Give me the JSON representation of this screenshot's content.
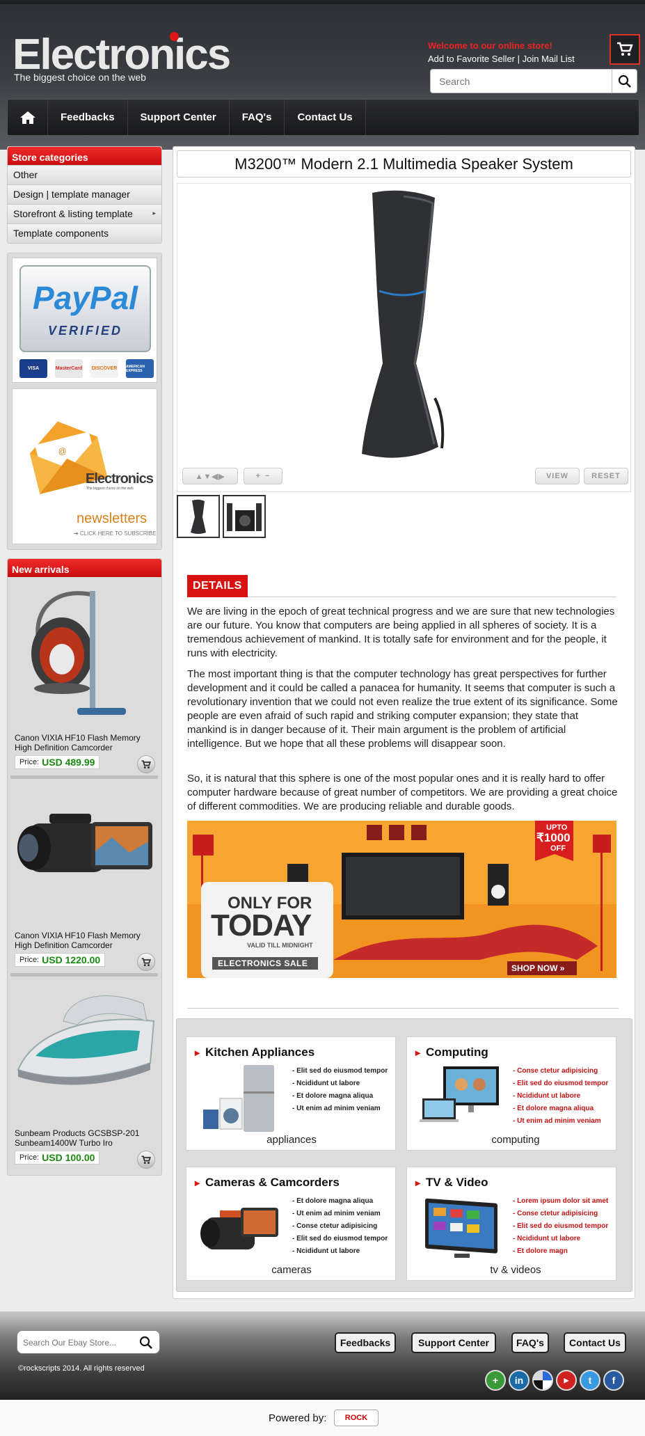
{
  "header": {
    "logo": "Electronics",
    "tagline": "The biggest choice on the web",
    "welcome": "Welcome to our online store!",
    "add_favorite": "Add to Favorite Seller",
    "link_sep": " | ",
    "join_mail": "Join Mail List",
    "search_placeholder": "Search",
    "cart_icon": "cart-icon",
    "search_icon": "search-icon"
  },
  "nav": {
    "home_icon": "home-icon",
    "items": [
      "Feedbacks",
      "Support Center",
      "FAQ's",
      "Contact Us"
    ]
  },
  "sidebar": {
    "categories_title": "Store categories",
    "categories": [
      "Other",
      "Design | template manager",
      "Storefront & listing template",
      "Template components"
    ],
    "paypal": {
      "logo_pay": "Pay",
      "logo_pal": "Pal",
      "verified": "VERIFIED",
      "cards": [
        "VISA",
        "MasterCard",
        "DISCOVER",
        "AMERICAN EXPRESS"
      ]
    },
    "newsletter": {
      "brand": "Electronics",
      "brand_sub": "The biggest choice on the web",
      "title": "newsletters",
      "click": "➔ CLICK HERE TO SUBSCRIBE"
    },
    "arrivals_title": "New arrivals",
    "price_label": "Price:",
    "products": [
      {
        "name": "Canon VIXIA HF10 Flash Memory High Definition Camcorder",
        "price": "USD 489.99"
      },
      {
        "name": "Canon VIXIA HF10 Flash Memory High Definition Camcorder",
        "price": "USD 1220.00"
      },
      {
        "name": "Sunbeam Products GCSBSP-201 Sunbeam1400W Turbo Iro",
        "price": "USD 100.00"
      }
    ]
  },
  "main": {
    "title": "M3200™ Modern 2.1 Multimedia Speaker System",
    "viewer": {
      "view": "VIEW",
      "reset": "RESET",
      "zoom_in": "+",
      "zoom_out": "−"
    },
    "details_title": "DETAILS",
    "paragraphs": [
      "We are living in the epoch of great technical progress and we are sure that new technologies are our future. You know that computers are being applied in all spheres of society. It is a tremendous achievement of mankind. It is totally safe for environment and for the people, it runs with electricity.",
      "The most important thing is that the computer technology has great perspectives for further development and it could be called a panacea for humanity. It seems that computer is such a revolutionary invention that we could not even realize the true extent of its significance. Some people are even afraid of such rapid and striking computer expansion; they state that mankind is in danger because of it. Their main argument is the problem of artificial intelligence. But we hope that all these problems will disappear soon.",
      "So, it is natural that this sphere is one of the most popular ones and it is really hard to offer computer hardware because of great number of competitors. We are providing a great choice of different commodities. We are producing reliable and durable goods."
    ],
    "banner": {
      "only_for": "ONLY FOR",
      "today": "TODAY",
      "valid": "VALID TILL MIDNIGHT",
      "sale": "ELECTRONICS SALE",
      "upto": "UPTO",
      "amount": "₹1000",
      "off": "OFF",
      "shop_now": "SHOP NOW »"
    },
    "category_cards": [
      {
        "title": "Kitchen Appliances",
        "caption": "appliances",
        "color": "#111111",
        "items": [
          "- Elit sed do eiusmod tempor",
          "- Ncididunt ut labore",
          "- Et dolore magna aliqua",
          "- Ut enim ad minim veniam"
        ]
      },
      {
        "title": "Computing",
        "caption": "computing",
        "color": "#c41414",
        "items": [
          "- Conse ctetur adipisicing",
          "- Elit sed do eiusmod tempor",
          "- Ncididunt ut labore",
          "- Et dolore magna aliqua",
          "- Ut enim ad minim veniam"
        ]
      },
      {
        "title": "Cameras & Camcorders",
        "caption": "cameras",
        "color": "#111111",
        "items": [
          "- Et dolore magna aliqua",
          "- Ut enim ad minim veniam",
          "- Conse ctetur adipisicing",
          "- Elit sed do eiusmod tempor",
          "- Ncididunt ut labore"
        ]
      },
      {
        "title": "TV & Video",
        "caption": "tv & videos",
        "color": "#c41414",
        "items": [
          "- Lorem ipsum dolor sit amet",
          "- Conse ctetur adipisicing",
          "- Elit sed do eiusmod tempor",
          "- Ncididunt ut labore",
          "- Et dolore magn"
        ]
      }
    ]
  },
  "footer": {
    "search_placeholder": "Search Our Ebay Store...",
    "buttons": [
      "Feedbacks",
      "Support Center",
      "FAQ's",
      "Contact Us"
    ],
    "copyright": "©rockscripts 2014. All rights reserved",
    "social": [
      "google-plus-icon",
      "linkedin-icon",
      "delicious-icon",
      "youtube-icon",
      "twitter-icon",
      "facebook-icon"
    ],
    "powered_by": "Powered by:",
    "powered_logo": "ROCK"
  }
}
